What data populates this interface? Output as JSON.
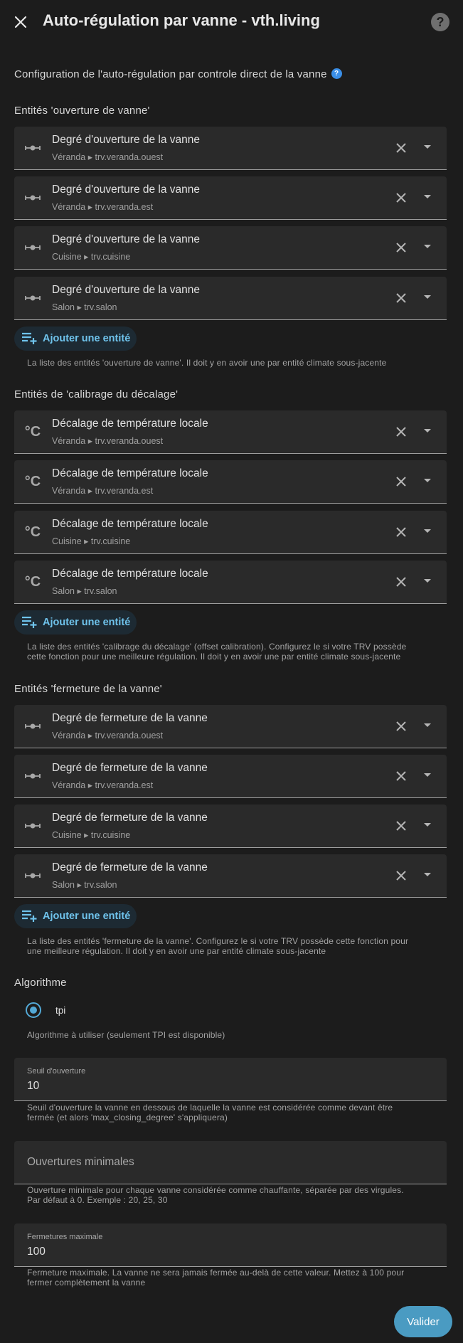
{
  "header": {
    "title": "Auto-régulation par vanne - vth.living",
    "help_symbol": "?"
  },
  "intro": "Configuration de l'auto-régulation par controle direct de la vanne",
  "add_label": "Ajouter une entité",
  "sections": {
    "opening": {
      "title": "Entités 'ouverture de vanne'",
      "items": [
        {
          "name": "Degré d'ouverture de la vanne",
          "sub": "Véranda ▸ trv.veranda.ouest"
        },
        {
          "name": "Degré d'ouverture de la vanne",
          "sub": "Véranda ▸ trv.veranda.est"
        },
        {
          "name": "Degré d'ouverture de la vanne",
          "sub": "Cuisine ▸ trv.cuisine"
        },
        {
          "name": "Degré d'ouverture de la vanne",
          "sub": "Salon ▸ trv.salon"
        }
      ],
      "helper": "La liste des entités 'ouverture de vanne'. Il doit y en avoir une par entité climate sous-jacente"
    },
    "offset": {
      "title": "Entités de 'calibrage du décalage'",
      "items": [
        {
          "name": "Décalage de température locale",
          "sub": "Véranda ▸ trv.veranda.ouest"
        },
        {
          "name": "Décalage de température locale",
          "sub": "Véranda ▸ trv.veranda.est"
        },
        {
          "name": "Décalage de température locale",
          "sub": "Cuisine ▸ trv.cuisine"
        },
        {
          "name": "Décalage de température locale",
          "sub": "Salon ▸ trv.salon"
        }
      ],
      "helper_line1": "La liste des entités 'calibrage du décalage' (offset calibration). Configurez le si votre TRV possède",
      "helper_line2": "cette fonction pour une meilleure régulation. Il doit y en avoir une par entité climate sous-jacente"
    },
    "closing": {
      "title": "Entités 'fermeture de la vanne'",
      "items": [
        {
          "name": "Degré de fermeture de la vanne",
          "sub": "Véranda ▸ trv.veranda.ouest"
        },
        {
          "name": "Degré de fermeture de la vanne",
          "sub": "Véranda ▸ trv.veranda.est"
        },
        {
          "name": "Degré de fermeture de la vanne",
          "sub": "Cuisine ▸ trv.cuisine"
        },
        {
          "name": "Degré de fermeture de la vanne",
          "sub": "Salon ▸ trv.salon"
        }
      ],
      "helper_line1": "La liste des entités 'fermeture de la vanne'. Configurez le si votre TRV possède cette fonction pour",
      "helper_line2": "une meilleure régulation. Il doit y en avoir une par entité climate sous-jacente"
    }
  },
  "algorithm": {
    "title": "Algorithme",
    "option": "tpi",
    "helper": "Algorithme à utiliser (seulement TPI est disponible)"
  },
  "fields": {
    "threshold": {
      "label": "Seuil d'ouverture",
      "value": "10",
      "helper_line1": "Seuil d'ouverture la vanne en dessous de laquelle la vanne est considérée comme devant être",
      "helper_line2": "fermée (et alors 'max_closing_degree' s'appliquera)"
    },
    "min_openings": {
      "placeholder": "Ouvertures minimales",
      "helper_line1": "Ouverture minimale pour chaque vanne considérée comme chauffante, séparée par des virgules.",
      "helper_line2": "Par défaut à 0. Exemple : 20, 25, 30"
    },
    "max_closing": {
      "label": "Fermetures maximale",
      "value": "100",
      "helper_line1": "Fermeture maximale. La vanne ne sera jamais fermée au-delà de cette valeur. Mettez à 100 pour",
      "helper_line2": "fermer complètement la vanne"
    }
  },
  "submit_label": "Valider",
  "colors": {
    "background": "#1c1c1c",
    "surface": "#2a2a2a",
    "accent": "#53a9d6",
    "submit": "#4a9bc2"
  }
}
